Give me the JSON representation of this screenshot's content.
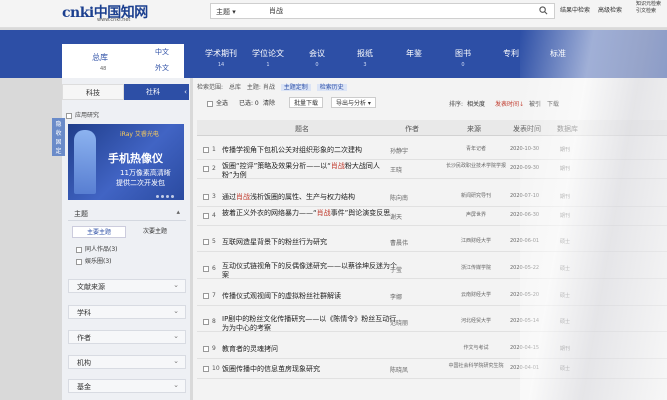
{
  "logo": {
    "text": "cnki中国知网",
    "url_text": "www.cnki.net"
  },
  "search": {
    "field": "主题",
    "query": "肖战"
  },
  "top_links": [
    "结果中检索",
    "高级检索"
  ],
  "top_user": [
    "知识元检索",
    "引文检索"
  ],
  "db_tab": {
    "title": "总库",
    "count": "48",
    "lang_zh": "中文",
    "lang_en": "外文"
  },
  "nav": [
    {
      "label": "学术期刊",
      "count": "14"
    },
    {
      "label": "学位论文",
      "count": "1"
    },
    {
      "label": "会议",
      "count": "0"
    },
    {
      "label": "报纸",
      "count": "3"
    },
    {
      "label": "年鉴",
      "count": ""
    },
    {
      "label": "图书",
      "count": "0"
    },
    {
      "label": "专利",
      "count": ""
    },
    {
      "label": "标准",
      "count": ""
    }
  ],
  "left": {
    "subtab_a": "科技",
    "subtab_b": "社科",
    "collapse": "‹",
    "applied": "应用研究",
    "side_icons": "隐 收 固 定",
    "ad": {
      "brand": "iRay 艾睿光电",
      "headline": "手机热像仪",
      "line2": "11万像素高清晰",
      "line3": "提供二次开发包"
    },
    "topic_title": "主题",
    "topic_sub_main": "主要主题",
    "topic_sub_minor": "次要主题",
    "topic_items": [
      "同人作品(3)",
      "娱乐圈(3)"
    ],
    "facets": [
      "文献来源",
      "学科",
      "作者",
      "机构",
      "基金"
    ]
  },
  "scope": {
    "label": "检索范围:",
    "items": [
      "总库",
      "主题: 肖战"
    ],
    "chips": [
      "主题定制",
      "检索历史"
    ]
  },
  "toolbar": {
    "select_all": "全选",
    "selected": "已选: 0",
    "clear": "清除",
    "batch": "批量下载",
    "export": "导出与分析 ▾",
    "sort_label": "排序:",
    "sort_options": [
      "相关度",
      "发表时间↓",
      "被引",
      "下载"
    ]
  },
  "table_head": {
    "title": "题名",
    "author": "作者",
    "source": "来源",
    "date": "发表时间",
    "db": "数据库"
  },
  "rows": [
    {
      "num": "1",
      "title_pre": "传播学视角下包机公关对组织形象的二次建构",
      "hl": "",
      "title_post": "",
      "author": "孙静宇",
      "source": "青年记者",
      "date": "2020-10-30",
      "db": "期刊"
    },
    {
      "num": "2",
      "title_pre": "饭圈“控评”策略及效果分析——以“",
      "hl": "肖战",
      "title_post": "粉大战同人粉”为例",
      "author": "王晓",
      "source": "长沙民政职业技术学院学报",
      "date": "2020-09-30",
      "db": "期刊"
    },
    {
      "num": "3",
      "title_pre": "通过",
      "hl": "肖战",
      "title_post": "浅析饭圈的属性、生产与权力结构",
      "author": "陈向南",
      "source": "新闻研究导刊",
      "date": "2020-07-10",
      "db": "期刊"
    },
    {
      "num": "4",
      "title_pre": "披着正义外衣的网络暴力——“",
      "hl": "肖战",
      "title_post": "事件”舆论演变反思",
      "author": "谢天",
      "source": "声屏世界",
      "date": "2020-06-30",
      "db": "期刊"
    },
    {
      "num": "5",
      "title_pre": "互联网造星背景下的粉丝行为研究",
      "hl": "",
      "title_post": "",
      "author": "曹晨伟",
      "source": "江西财经大学",
      "date": "2020-06-01",
      "db": "硕士"
    },
    {
      "num": "6",
      "title_pre": "互动仪式链视角下的反偶像迷研究——以蔡徐坤反迷为个案",
      "hl": "",
      "title_post": "",
      "author": "于莹",
      "source": "浙江传媒学院",
      "date": "2020-05-22",
      "db": "硕士"
    },
    {
      "num": "7",
      "title_pre": "传播仪式观视阈下的虚拟粉丝社群解读",
      "hl": "",
      "title_post": "",
      "author": "李娜",
      "source": "云南财经大学",
      "date": "2020-05-20",
      "db": "硕士"
    },
    {
      "num": "8",
      "title_pre": "IP剧中的粉丝文化传播研究——以《陈情令》粉丝互动行为为中心的考察",
      "hl": "",
      "title_post": "",
      "author": "范晓丽",
      "source": "河北经贸大学",
      "date": "2020-05-14",
      "db": "硕士"
    },
    {
      "num": "9",
      "title_pre": "教育者的灵魂拷问",
      "hl": "",
      "title_post": "",
      "author": "",
      "source": "作文与考试",
      "date": "2020-04-15",
      "db": "期刊"
    },
    {
      "num": "10",
      "title_pre": "饭圈传播中的信息茧房现象研究",
      "hl": "",
      "title_post": "",
      "author": "陈晓凤",
      "source": "中国社会科学院研究生院",
      "date": "2020-04-01",
      "db": "硕士"
    }
  ]
}
